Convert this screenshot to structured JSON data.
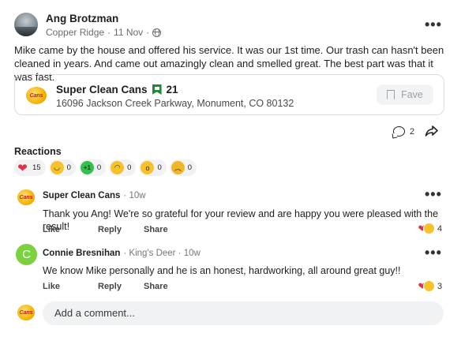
{
  "post": {
    "author": "Ang Brotzman",
    "location": "Copper Ridge",
    "date": "11 Nov",
    "separator": "·",
    "body": "Mike came by the house and offered his service. It was our 1st time. Our trash can hasn't been cleaned in years. And came out amazingly clean and smelled great. The best part was that it was fast.",
    "more_icon": "more-dots-icon"
  },
  "business": {
    "name": "Super Clean Cans",
    "fave_count": "21",
    "address": "16096 Jackson Creek Parkway, Monument, CO 80132",
    "fave_label": "Fave",
    "logo_text": "Cans"
  },
  "engagement": {
    "comment_count": "2"
  },
  "reactions": {
    "title": "Reactions",
    "items": [
      {
        "icon": "heart-icon",
        "count": "15"
      },
      {
        "icon": "smile-icon",
        "count": "0"
      },
      {
        "icon": "plus-one-icon",
        "glyph": "+1",
        "count": "0"
      },
      {
        "icon": "grin-icon",
        "count": "0"
      },
      {
        "icon": "wow-icon",
        "count": "0"
      },
      {
        "icon": "sad-icon",
        "count": "0"
      }
    ]
  },
  "comments": [
    {
      "author": "Super Clean Cans",
      "meta": "· 10w",
      "text": "Thank you Ang!  We're so grateful for your review and are happy you were pleased with the result!",
      "like": "Like",
      "reply": "Reply",
      "share": "Share",
      "reaction_count": "4"
    },
    {
      "author": "Connie Bresnihan",
      "meta": "· King's Deer · 10w",
      "avatar_letter": "C",
      "text": "We know Mike personally and he is an honest, hardworking, all around great guy!!",
      "like": "Like",
      "reply": "Reply",
      "share": "Share",
      "reaction_count": "3"
    }
  ],
  "composer": {
    "placeholder": "Add a comment..."
  },
  "colors": {
    "accent_green": "#1d8a34",
    "avatar_green": "#7cd13f",
    "heart_red": "#e0314b",
    "emoji_yellow": "#f5c22b"
  }
}
